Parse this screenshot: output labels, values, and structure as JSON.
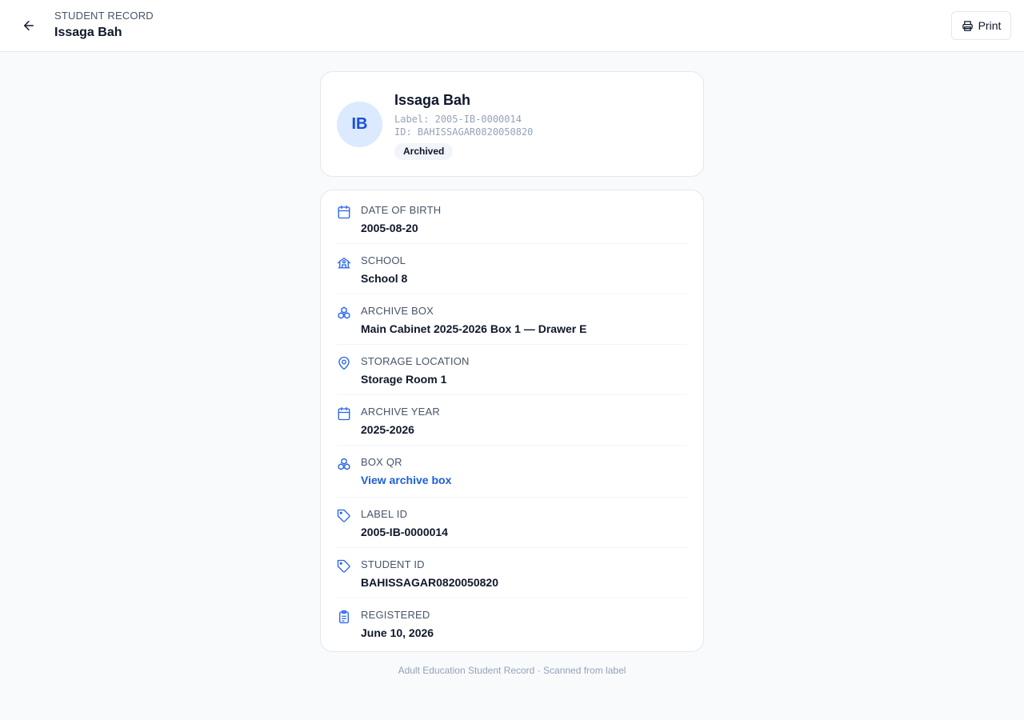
{
  "header": {
    "kicker": "STUDENT RECORD",
    "title": "Issaga Bah",
    "print_label": "Print"
  },
  "profile": {
    "initials": "IB",
    "name": "Issaga Bah",
    "label_line": "Label: 2005-IB-0000014",
    "id_line": "ID: BAHISSAGAR0820050820",
    "status": "Archived"
  },
  "details": [
    {
      "label": "DATE OF BIRTH",
      "value": "2005-08-20",
      "icon": "calendar-icon"
    },
    {
      "label": "SCHOOL",
      "value": "School 8",
      "icon": "school-icon"
    },
    {
      "label": "ARCHIVE BOX",
      "value": "Main Cabinet 2025-2026 Box 1 — Drawer E",
      "icon": "boxes-icon"
    },
    {
      "label": "STORAGE LOCATION",
      "value": "Storage Room 1",
      "icon": "map-pin-icon"
    },
    {
      "label": "ARCHIVE YEAR",
      "value": "2025-2026",
      "icon": "calendar-icon"
    },
    {
      "label": "BOX QR",
      "value": "View archive box",
      "icon": "boxes-icon",
      "link": true
    },
    {
      "label": "LABEL ID",
      "value": "2005-IB-0000014",
      "icon": "tag-icon"
    },
    {
      "label": "STUDENT ID",
      "value": "BAHISSAGAR0820050820",
      "icon": "tag-icon"
    },
    {
      "label": "REGISTERED",
      "value": "June 10, 2026",
      "icon": "clipboard-icon"
    }
  ],
  "footer": "Adult Education Student Record · Scanned from label",
  "colors": {
    "accent": "#1d5fd6",
    "icon": "#2563eb",
    "avatar_bg": "#dbeafe"
  }
}
